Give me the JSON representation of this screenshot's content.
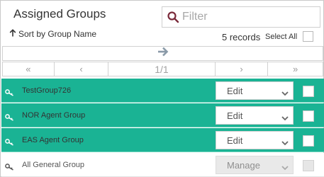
{
  "header": {
    "title": "Assigned Groups",
    "filter_placeholder": "Filter",
    "sort_label": "Sort by Group Name",
    "records": "5 records",
    "select_all_label": "Select All"
  },
  "pager": {
    "first": "«",
    "prev": "‹",
    "page": "1/1",
    "next": "›",
    "last": "»"
  },
  "rows": [
    {
      "name": "TestGroup726",
      "action": "Edit",
      "selected": true
    },
    {
      "name": "NOR Agent Group",
      "action": "Edit",
      "selected": true
    },
    {
      "name": "EAS Agent Group",
      "action": "Edit",
      "selected": true
    },
    {
      "name": "All General Group",
      "action": "Manage",
      "selected": false,
      "disabled": true
    }
  ],
  "colors": {
    "selected_row": "#1ab394",
    "search_icon": "#7a2a3a",
    "forward_arrow": "#8a9aa8"
  },
  "icons": [
    "search-icon",
    "arrow-up-icon",
    "arrow-right-icon",
    "key-icon",
    "chevron-down-icon"
  ]
}
